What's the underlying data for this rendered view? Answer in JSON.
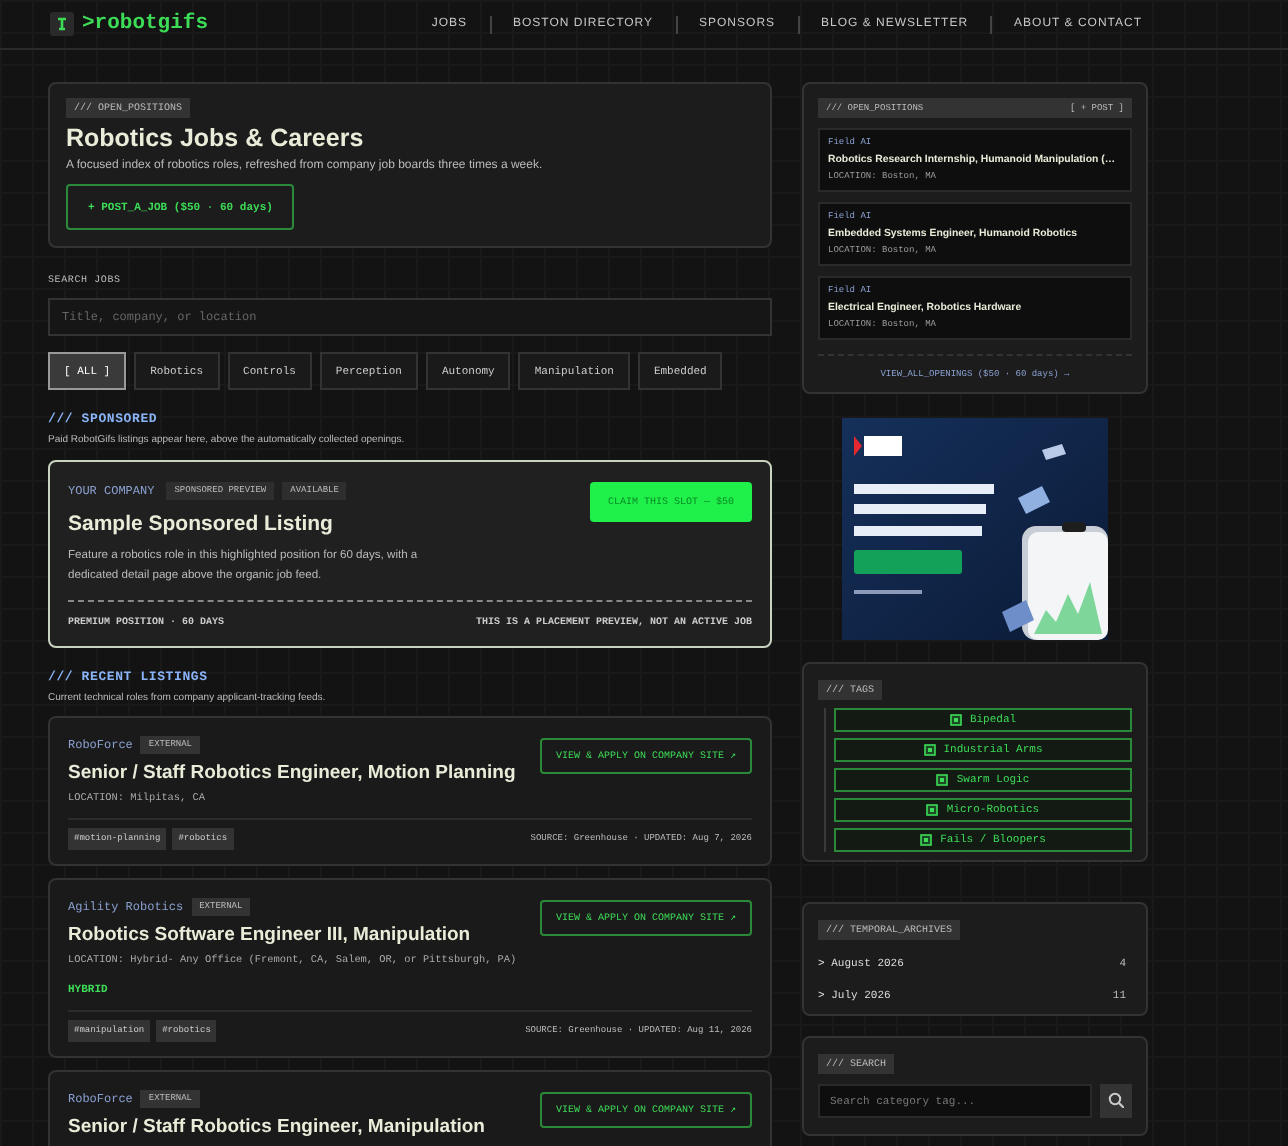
{
  "header": {
    "logo": ">robotgifs",
    "nav": [
      {
        "label": "JOBS"
      },
      {
        "label": "BOSTON DIRECTORY"
      },
      {
        "label": "SPONSORS"
      },
      {
        "label": "BLOG & NEWSLETTER"
      },
      {
        "label": "ABOUT & CONTACT"
      }
    ]
  },
  "hero": {
    "badge": "/// OPEN_POSITIONS",
    "title": "Robotics Jobs & Careers",
    "description": "A focused index of robotics roles, refreshed from company job boards three times a week.",
    "post_button": "+ POST_A_JOB ($50 · 60 days)"
  },
  "search": {
    "label": "SEARCH JOBS",
    "placeholder": "Title, company, or location"
  },
  "filters": [
    {
      "label": "[ ALL ]",
      "selected": true
    },
    {
      "label": "Robotics",
      "selected": false
    },
    {
      "label": "Controls",
      "selected": false
    },
    {
      "label": "Perception",
      "selected": false
    },
    {
      "label": "Autonomy",
      "selected": false
    },
    {
      "label": "Manipulation",
      "selected": false
    },
    {
      "label": "Embedded",
      "selected": false
    }
  ],
  "sponsored": {
    "heading": "/// SPONSORED",
    "subtitle": "Paid RobotGifs listings appear here, above the automatically collected openings.",
    "card": {
      "company": "YOUR COMPANY",
      "badges": [
        "SPONSORED PREVIEW",
        "AVAILABLE"
      ],
      "title": "Sample Sponsored Listing",
      "description": "Feature a robotics role in this highlighted position for 60 days, with a dedicated detail page above the organic job feed.",
      "claim_button": "CLAIM THIS SLOT — $50",
      "footer_left": "PREMIUM POSITION · 60 DAYS",
      "footer_right": "THIS IS A PLACEMENT PREVIEW, NOT AN ACTIVE JOB"
    }
  },
  "recent": {
    "heading": "/// RECENT LISTINGS",
    "subtitle": "Current technical roles from company applicant-tracking feeds.",
    "listings": [
      {
        "company": "RoboForce",
        "badge": "EXTERNAL",
        "title": "Senior / Staff Robotics Engineer, Motion Planning",
        "location": "LOCATION: Milpitas, CA",
        "tags": [
          "#motion-planning",
          "#robotics"
        ],
        "meta": "SOURCE: Greenhouse · UPDATED: Aug 7, 2026",
        "apply_button": "VIEW & APPLY ON COMPANY SITE ↗"
      },
      {
        "company": "Agility Robotics",
        "badge": "EXTERNAL",
        "title": "Robotics Software Engineer III, Manipulation",
        "location": "LOCATION: Hybrid- Any Office (Fremont, CA, Salem, OR, or Pittsburgh, PA)",
        "work_mode": "HYBRID",
        "tags": [
          "#manipulation",
          "#robotics"
        ],
        "meta": "SOURCE: Greenhouse · UPDATED: Aug 11, 2026",
        "apply_button": "VIEW & APPLY ON COMPANY SITE ↗"
      },
      {
        "company": "RoboForce",
        "badge": "EXTERNAL",
        "title": "Senior / Staff Robotics Engineer, Manipulation",
        "apply_button": "VIEW & APPLY ON COMPANY SITE ↗"
      }
    ]
  },
  "sidebar": {
    "open_positions": {
      "badge": "/// OPEN_POSITIONS",
      "post_link": "[ + POST ]",
      "items": [
        {
          "company": "Field AI",
          "title": "Robotics Research Internship, Humanoid Manipulation (…",
          "location": "LOCATION: Boston, MA"
        },
        {
          "company": "Field AI",
          "title": "Embedded Systems Engineer, Humanoid Robotics",
          "location": "LOCATION: Boston, MA"
        },
        {
          "company": "Field AI",
          "title": "Electrical Engineer, Robotics Hardware",
          "location": "LOCATION: Boston, MA"
        }
      ],
      "view_all": "VIEW_ALL_OPENINGS ($50 · 60 days) →"
    },
    "tags": {
      "badge": "/// TAGS",
      "items": [
        "Bipedal",
        "Industrial Arms",
        "Swarm Logic",
        "Micro-Robotics",
        "Fails / Bloopers"
      ]
    },
    "archives": {
      "badge": "/// TEMPORAL_ARCHIVES",
      "items": [
        {
          "label": "> August 2026",
          "count": "4"
        },
        {
          "label": "> July 2026",
          "count": "11"
        }
      ]
    },
    "search": {
      "badge": "/// SEARCH",
      "placeholder": "Search category tag..."
    }
  }
}
